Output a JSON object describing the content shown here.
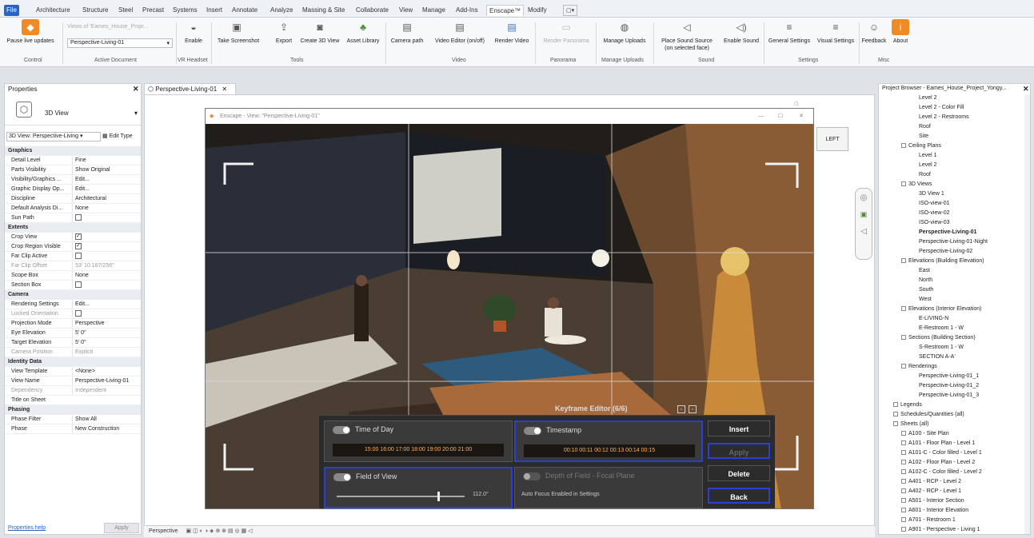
{
  "tabs": [
    "File",
    "Architecture",
    "Structure",
    "Steel",
    "Precast",
    "Systems",
    "Insert",
    "Annotate",
    "Analyze",
    "Massing & Site",
    "Collaborate",
    "View",
    "Manage",
    "Add-Ins",
    "Enscape™",
    "Modify"
  ],
  "ribbon": {
    "pause_live_updates": "Pause live updates",
    "views_of_label": "Views of 'Eames_House_Proje...",
    "active_document_value": "Perspective-Living-01",
    "enable": "Enable",
    "take_screenshot": "Take Screenshot",
    "export": "Export",
    "create_3d_view": "Create 3D View",
    "asset_library": "Asset Library",
    "camera_path": "Camera path",
    "video_editor": "Video Editor (on/off)",
    "render_video": "Render Video",
    "render_panorama": "Render Panorama",
    "manage_uploads": "Manage Uploads",
    "place_sound_source": "Place Sound Source",
    "on_selected_face": "(on selected face)",
    "enable_sound": "Enable Sound",
    "general_settings": "General Settings",
    "visual_settings": "Visual Settings",
    "feedback": "Feedback",
    "about": "About",
    "groups": {
      "control": "Control",
      "active_document": "Active Document",
      "vr_headset": "VR Headset",
      "tools": "Tools",
      "video": "Video",
      "panorama": "Panorama",
      "manage_uploads": "Manage Uploads",
      "sound": "Sound",
      "settings": "Settings",
      "misc": "Misc"
    }
  },
  "properties": {
    "title": "Properties",
    "type_name": "3D View",
    "selector": "3D View: Perspective-Living",
    "edit_type": "Edit Type",
    "help_link": "Properties help",
    "apply": "Apply",
    "rows": [
      {
        "k": "Graphics",
        "v": "",
        "cat": true
      },
      {
        "k": "Detail Level",
        "v": "Fine"
      },
      {
        "k": "Parts Visibility",
        "v": "Show Original"
      },
      {
        "k": "Visibility/Graphics ...",
        "v": "Edit..."
      },
      {
        "k": "Graphic Display Op...",
        "v": "Edit..."
      },
      {
        "k": "Discipline",
        "v": "Architectural"
      },
      {
        "k": "Default Analysis Di...",
        "v": "None"
      },
      {
        "k": "Sun Path",
        "v": ""
      },
      {
        "k": "Extents",
        "v": "",
        "cat": true
      },
      {
        "k": "Crop View",
        "v": ""
      },
      {
        "k": "Crop Region Visible",
        "v": ""
      },
      {
        "k": "Far Clip Active",
        "v": ""
      },
      {
        "k": "Far Clip Offset",
        "v": "53' 10 187/256\"",
        "gray": true
      },
      {
        "k": "Scope Box",
        "v": "None"
      },
      {
        "k": "Section Box",
        "v": ""
      },
      {
        "k": "Camera",
        "v": "",
        "cat": true
      },
      {
        "k": "Rendering Settings",
        "v": "Edit..."
      },
      {
        "k": "Locked Orientation",
        "v": "",
        "gray": true
      },
      {
        "k": "Projection Mode",
        "v": "Perspective"
      },
      {
        "k": "Eye Elevation",
        "v": "5' 0\""
      },
      {
        "k": "Target Elevation",
        "v": "5' 0\""
      },
      {
        "k": "Camera Position",
        "v": "Explicit",
        "gray": true
      },
      {
        "k": "Identity Data",
        "v": "",
        "cat": true
      },
      {
        "k": "View Template",
        "v": "<None>"
      },
      {
        "k": "View Name",
        "v": "Perspective-Living-01"
      },
      {
        "k": "Dependency",
        "v": "Independent",
        "gray": true
      },
      {
        "k": "Title on Sheet",
        "v": ""
      },
      {
        "k": "Phasing",
        "v": "",
        "cat": true
      },
      {
        "k": "Phase Filter",
        "v": "Show All"
      },
      {
        "k": "Phase",
        "v": "New Construction"
      }
    ]
  },
  "view_tab": "Perspective-Living-01",
  "enscape": {
    "title": "Enscape - View: \"Perspective-Living-01\"",
    "cube_label": "LEFT",
    "kf_title": "Keyframe Editor (6/6)",
    "time_of_day": "Time of Day",
    "tod_scale": "15:00 16:00 17:00 18:00 19:00 20:00 21:00",
    "timestamp": "Timestamp",
    "ts_scale": "00:10 00:11 00:12 00:13 00:14 00:15",
    "field_of_view": "Field of View",
    "fov_value": "112.0°",
    "depth_of_field": "Depth of Field - Focal Plane",
    "auto_focus": "Auto Focus Enabled in Settings",
    "insert": "Insert",
    "apply": "Apply",
    "delete": "Delete",
    "back": "Back"
  },
  "status": {
    "text": "Perspective"
  },
  "browser": {
    "title": "Project Browser - Eames_House_Project_Yongy...",
    "items": [
      {
        "t": "Level 2",
        "lvl": 2
      },
      {
        "t": "Level 2 - Color Fill",
        "lvl": 2
      },
      {
        "t": "Level 2 - Restrooms",
        "lvl": 2
      },
      {
        "t": "Roof",
        "lvl": 2
      },
      {
        "t": "Site",
        "lvl": 2
      },
      {
        "t": "Ceiling Plans",
        "lvl": 1
      },
      {
        "t": "Level 1",
        "lvl": 2
      },
      {
        "t": "Level 2",
        "lvl": 2
      },
      {
        "t": "Roof",
        "lvl": 2
      },
      {
        "t": "3D Views",
        "lvl": 1
      },
      {
        "t": "3D View 1",
        "lvl": 2
      },
      {
        "t": "ISO-view-01",
        "lvl": 2
      },
      {
        "t": "ISO-view-02",
        "lvl": 2
      },
      {
        "t": "ISO-view-03",
        "lvl": 2
      },
      {
        "t": "Perspective-Living-01",
        "lvl": 2,
        "b": true
      },
      {
        "t": "Perspective-Living-01-Night",
        "lvl": 2
      },
      {
        "t": "Perspective-Living-02",
        "lvl": 2
      },
      {
        "t": "Elevations (Building Elevation)",
        "lvl": 1
      },
      {
        "t": "East",
        "lvl": 2
      },
      {
        "t": "North",
        "lvl": 2
      },
      {
        "t": "South",
        "lvl": 2
      },
      {
        "t": "West",
        "lvl": 2
      },
      {
        "t": "Elevations (Interior Elevation)",
        "lvl": 1
      },
      {
        "t": "E-LIVING-N",
        "lvl": 2
      },
      {
        "t": "E-Restroom 1 - W",
        "lvl": 2
      },
      {
        "t": "Sections (Building Section)",
        "lvl": 1
      },
      {
        "t": "S-Restroom 1 - W",
        "lvl": 2
      },
      {
        "t": "SECTION A-A'",
        "lvl": 2
      },
      {
        "t": "Renderings",
        "lvl": 1
      },
      {
        "t": "Perspective-Living-01_1",
        "lvl": 2
      },
      {
        "t": "Perspective-Living-01_2",
        "lvl": 2
      },
      {
        "t": "Perspective-Living-01_3",
        "lvl": 2
      },
      {
        "t": "Legends",
        "lvl": 0
      },
      {
        "t": "Schedules/Quantities (all)",
        "lvl": 0
      },
      {
        "t": "Sheets (all)",
        "lvl": 0
      },
      {
        "t": "A100 - Site Plan",
        "lvl": 1
      },
      {
        "t": "A101 - Floor Plan - Level 1",
        "lvl": 1
      },
      {
        "t": "A101-C - Color filled - Level 1",
        "lvl": 1
      },
      {
        "t": "A102 - Floor Plan - Level 2",
        "lvl": 1
      },
      {
        "t": "A102-C - Color filled - Level 2",
        "lvl": 1
      },
      {
        "t": "A401 - RCP - Level 2",
        "lvl": 1
      },
      {
        "t": "A402 - RCP - Level 1",
        "lvl": 1
      },
      {
        "t": "A501 - Interior Section",
        "lvl": 1
      },
      {
        "t": "A601 - Interior Elevation",
        "lvl": 1
      },
      {
        "t": "A701 - Restroom 1",
        "lvl": 1
      },
      {
        "t": "A901 - Perspective - Living 1",
        "lvl": 1
      }
    ]
  }
}
